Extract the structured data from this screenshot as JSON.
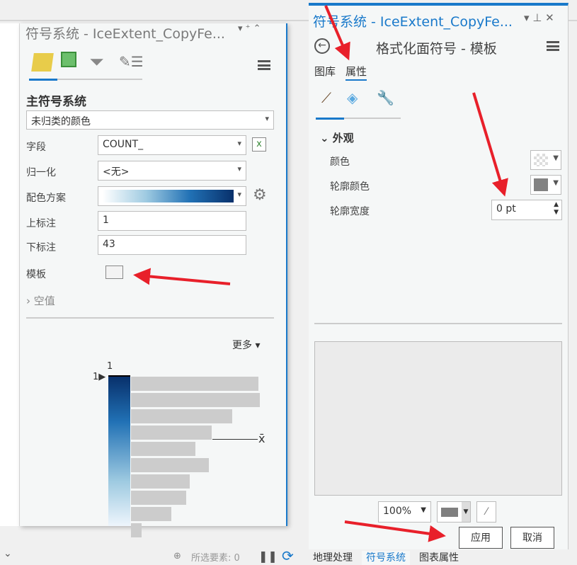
{
  "left_panel": {
    "title": "符号系统 - IceExtent_CopyFe...",
    "section_title": "主符号系统",
    "symbology_method": "未归类的颜色",
    "field_label": "字段",
    "field_value": "COUNT_",
    "normalization_label": "归一化",
    "normalization_value": "<无>",
    "color_scheme_label": "配色方案",
    "upper_label": "上标注",
    "upper_value": "1",
    "lower_label": "下标注",
    "lower_value": "43",
    "template_label": "模板",
    "null_values_label": "空值",
    "more_label": "更多",
    "histogram": {
      "top_value": "1",
      "marker_value": "1",
      "stat_label": "x̄",
      "bars": [
        180,
        182,
        143,
        114,
        91,
        110,
        83,
        78,
        57,
        15
      ]
    }
  },
  "right_panel": {
    "title": "符号系统 - IceExtent_CopyFe...",
    "subtitle": "格式化面符号 - 模板",
    "tabs": [
      "图库",
      "属性"
    ],
    "active_tab": "属性",
    "section": "外观",
    "color_label": "颜色",
    "outline_color_label": "轮廓颜色",
    "outline_width_label": "轮廓宽度",
    "outline_width_value": "0 pt",
    "zoom_value": "100%",
    "apply_label": "应用",
    "cancel_label": "取消"
  },
  "bottom_tabs": [
    "地理处理",
    "符号系统",
    "图表属性"
  ],
  "active_bottom_tab": "符号系统",
  "status": {
    "selected_features": "所选要素: 0"
  },
  "colors": {
    "accent": "#1979ca",
    "annotation_arrow": "#e8202a",
    "ramp_start": "#eef5fc",
    "ramp_end": "#08306b"
  }
}
